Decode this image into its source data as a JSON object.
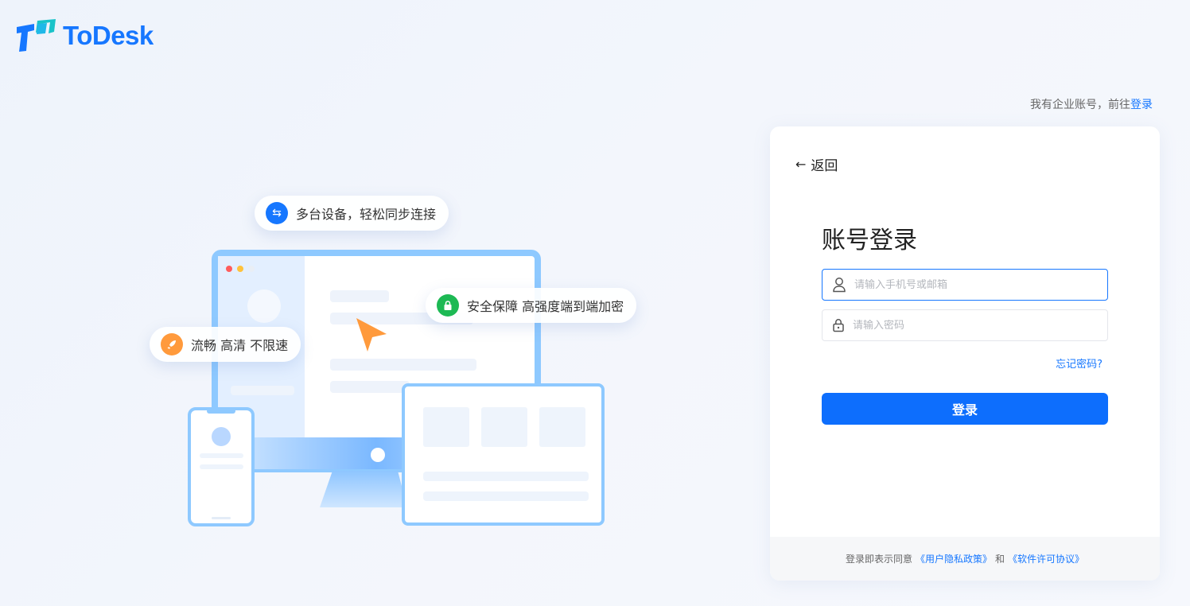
{
  "brand": {
    "name": "ToDesk",
    "color": "#1677ff"
  },
  "enterprise": {
    "prefix": "我有企业账号，前往",
    "link": "登录"
  },
  "illustration": {
    "pill_sync": "多台设备，轻松同步连接",
    "pill_secure": "安全保障 高强度端到端加密",
    "pill_smooth": "流畅 高清 不限速",
    "icons": {
      "sync": "swap-arrows-icon",
      "secure": "lock-icon",
      "smooth": "rocket-icon"
    }
  },
  "login": {
    "back_label": "返回",
    "title": "账号登录",
    "account_placeholder": "请输入手机号或邮箱",
    "password_placeholder": "请输入密码",
    "forgot": "忘记密码?",
    "submit": "登录"
  },
  "footer": {
    "prefix": "登录即表示同意",
    "privacy": "《用户隐私政策》",
    "and": "和",
    "license": "《软件许可协议》"
  },
  "colors": {
    "accent": "#1677ff",
    "button": "#0d6efd",
    "green": "#1db954",
    "orange": "#ff9a3c"
  }
}
